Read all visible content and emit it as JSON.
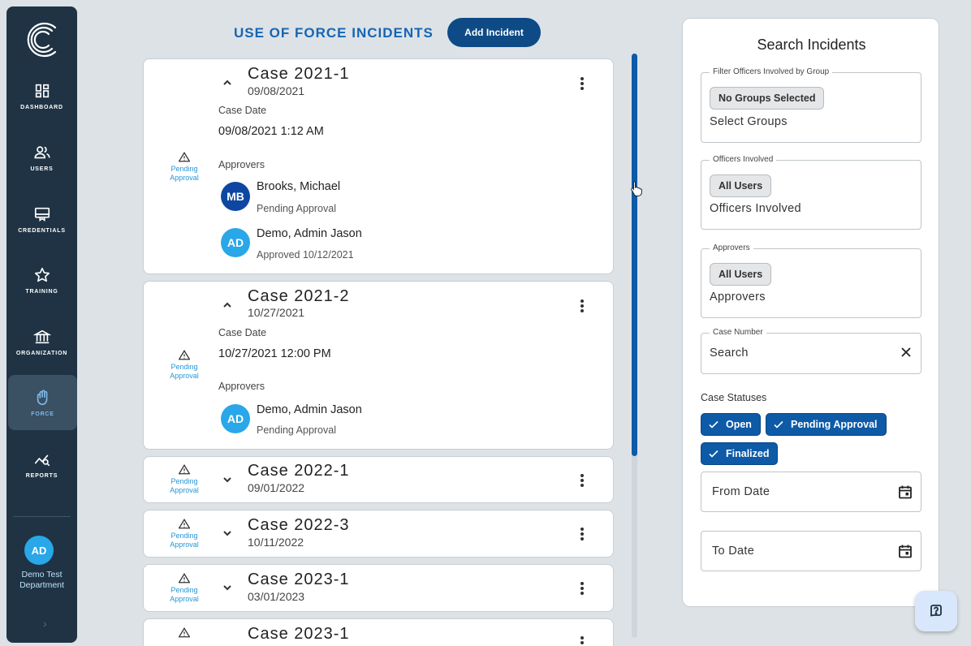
{
  "sidebar": {
    "items": [
      {
        "label": "DASHBOARD",
        "icon": "dashboard-icon"
      },
      {
        "label": "USERS",
        "icon": "users-icon"
      },
      {
        "label": "CREDENTIALS",
        "icon": "credentials-icon"
      },
      {
        "label": "TRAINING",
        "icon": "star-icon"
      },
      {
        "label": "ORGANIZATION",
        "icon": "bank-icon"
      },
      {
        "label": "FORCE",
        "icon": "hand-icon",
        "active": true
      },
      {
        "label": "REPORTS",
        "icon": "reports-icon"
      }
    ],
    "user_initials": "AD",
    "department": "Demo Test Department",
    "expand_icon": "chevron-right-icon"
  },
  "header": {
    "title": "USE OF FORCE INCIDENTS",
    "add_button": "Add Incident"
  },
  "cases": [
    {
      "title": "Case 2021-1",
      "date": "09/08/2021",
      "status": "Pending Approval",
      "expanded": true,
      "case_date_label": "Case Date",
      "case_date": "09/08/2021 1:12 AM",
      "approvers_label": "Approvers",
      "approvers": [
        {
          "initials": "MB",
          "name": "Brooks, Michael",
          "status": "Pending Approval",
          "color": "#0d47a1"
        },
        {
          "initials": "AD",
          "name": "Demo, Admin Jason",
          "status": "Approved 10/12/2021",
          "color": "#29a7e8"
        }
      ]
    },
    {
      "title": "Case 2021-2",
      "date": "10/27/2021",
      "status": "Pending Approval",
      "expanded": true,
      "case_date_label": "Case Date",
      "case_date": "10/27/2021 12:00 PM",
      "approvers_label": "Approvers",
      "approvers": [
        {
          "initials": "AD",
          "name": "Demo, Admin Jason",
          "status": "Pending Approval",
          "color": "#29a7e8"
        }
      ]
    },
    {
      "title": "Case 2022-1",
      "date": "09/01/2022",
      "status": "Pending Approval",
      "expanded": false
    },
    {
      "title": "Case 2022-3",
      "date": "10/11/2022",
      "status": "Pending Approval",
      "expanded": false
    },
    {
      "title": "Case 2023-1",
      "date": "03/01/2023",
      "status": "Pending Approval",
      "expanded": false
    },
    {
      "title": "Case 2023-1",
      "date": "",
      "status": "",
      "expanded": false
    }
  ],
  "search": {
    "title": "Search Incidents",
    "group_filter": {
      "legend": "Filter Officers Involved by Group",
      "chip": "No Groups Selected",
      "placeholder": "Select Groups"
    },
    "officers": {
      "legend": "Officers Involved",
      "chip": "All Users",
      "placeholder": "Officers Involved"
    },
    "approvers": {
      "legend": "Approvers",
      "chip": "All Users",
      "placeholder": "Approvers"
    },
    "case_number": {
      "legend": "Case Number",
      "value": "Search"
    },
    "statuses_label": "Case Statuses",
    "statuses": [
      "Open",
      "Pending Approval",
      "Finalized"
    ],
    "from_date": "From Date",
    "to_date": "To Date"
  },
  "colors": {
    "accent": "#0d5aa7",
    "sidebar": "#1f3344",
    "title": "#1565b5"
  }
}
